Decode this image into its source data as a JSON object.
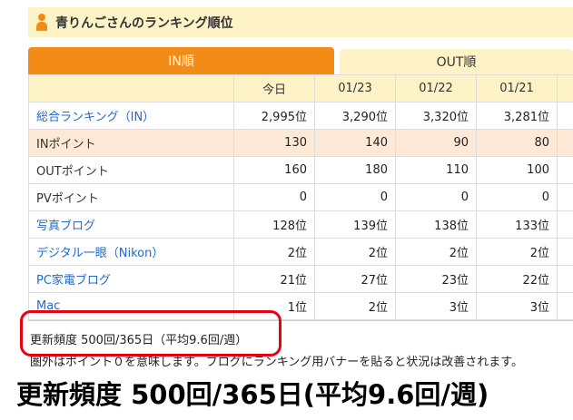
{
  "header": {
    "title": "青りんごさんのランキング順位",
    "icon": "person-icon"
  },
  "tabs": [
    {
      "label": "IN順",
      "active": true
    },
    {
      "label": "OUT順",
      "active": false
    }
  ],
  "table": {
    "columns": [
      "",
      "今日",
      "01/23",
      "01/22",
      "01/21"
    ],
    "rows": [
      {
        "label": "総合ランキング（IN）",
        "link": true,
        "values": [
          "2,995位",
          "3,290位",
          "3,320位",
          "3,281位"
        ]
      },
      {
        "label": "INポイント",
        "link": false,
        "values": [
          "130",
          "140",
          "90",
          "80"
        ]
      },
      {
        "label": "OUTポイント",
        "link": false,
        "values": [
          "160",
          "180",
          "110",
          "100"
        ]
      },
      {
        "label": "PVポイント",
        "link": false,
        "values": [
          "0",
          "0",
          "0",
          "0"
        ]
      },
      {
        "label": "写真ブログ",
        "link": true,
        "values": [
          "128位",
          "139位",
          "138位",
          "133位"
        ]
      },
      {
        "label": "デジタル一眼（Nikon）",
        "link": true,
        "values": [
          "2位",
          "2位",
          "2位",
          "2位"
        ]
      },
      {
        "label": "PC家電ブログ",
        "link": true,
        "values": [
          "21位",
          "27位",
          "23位",
          "22位"
        ]
      },
      {
        "label": "Mac",
        "link": true,
        "values": [
          "1位",
          "2位",
          "3位",
          "3位"
        ]
      }
    ]
  },
  "footer": {
    "frequency": "更新頻度 500回/365日（平均9.6回/週）",
    "note": "圏外はポイント０を意味します。ブログにランキング用バナーを貼ると状況は改善されます。"
  },
  "caption": "更新頻度 500回/365日(平均9.6回/週)",
  "colors": {
    "accent": "#f28c16",
    "highlight": "#e60012",
    "link": "#2369c9"
  }
}
